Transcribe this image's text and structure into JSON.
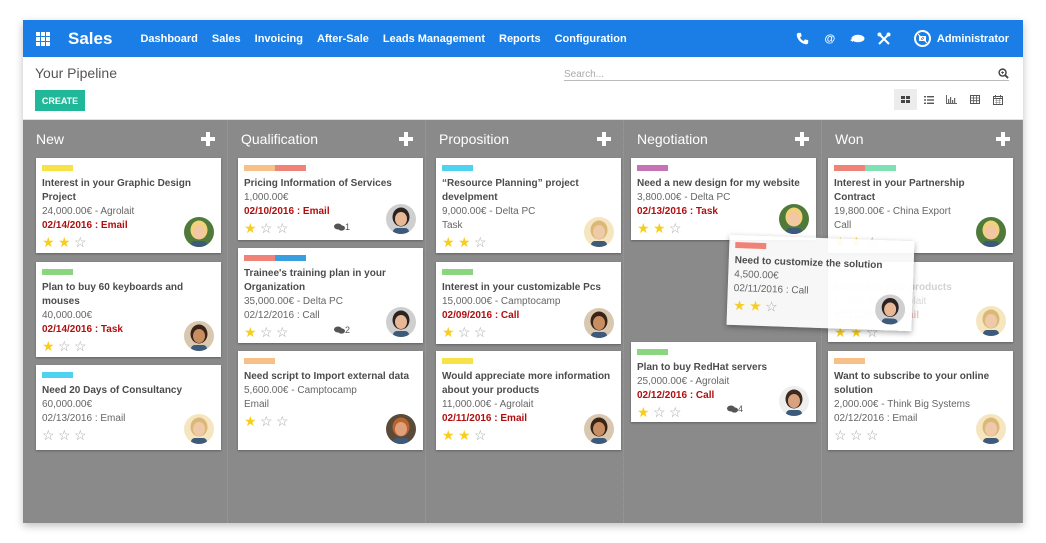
{
  "navbar": {
    "app_name": "Sales",
    "menu": [
      "Dashboard",
      "Sales",
      "Invoicing",
      "After-Sale",
      "Leads Management",
      "Reports",
      "Configuration"
    ],
    "icons": [
      "phone-icon",
      "at-icon",
      "chat-icon",
      "tools-icon"
    ],
    "user": "Administrator"
  },
  "control": {
    "title": "Your Pipeline",
    "search_placeholder": "Search...",
    "create_label": "CREATE",
    "views": [
      "kanban",
      "list",
      "graph",
      "pivot",
      "calendar"
    ],
    "active_view": "kanban"
  },
  "colors": {
    "navbar": "#1a7ee6",
    "create": "#21b799",
    "overdue": "#b10f0f",
    "star": "#f7cd1f",
    "kanban_bg": "#8a8a8a"
  },
  "columns": [
    {
      "title": "New",
      "cards": [
        {
          "tags": [
            "#f7e348"
          ],
          "title": "Interest in your Graphic Design Project",
          "amount": "24,000.00€ - Agrolait",
          "activity": "02/14/2016 : Email",
          "overdue": true,
          "stars": 2,
          "messages": "",
          "avatar": "blonde"
        },
        {
          "tags": [
            "#8ad57e"
          ],
          "title": "Plan to buy 60 keyboards and mouses",
          "amount": "40,000.00€",
          "activity": "02/14/2016 : Task",
          "overdue": true,
          "stars": 1,
          "messages": "",
          "avatar": "beard"
        },
        {
          "tags": [
            "#4fd2ef"
          ],
          "title": "Need 20 Days of Consultancy",
          "amount": "60,000.00€",
          "activity": "02/13/2016 : Email",
          "overdue": false,
          "stars": 0,
          "messages": "",
          "avatar": "blond-man"
        }
      ]
    },
    {
      "title": "Qualification",
      "cards": [
        {
          "tags": [
            "#f7c088",
            "#f08377"
          ],
          "title": "Pricing Information of Services",
          "amount": "1,000.00€",
          "activity": "02/10/2016 : Email",
          "overdue": true,
          "stars": 1,
          "messages": "1",
          "avatar": "dark-hair"
        },
        {
          "tags": [
            "#f08377",
            "#3a9fe0"
          ],
          "title": "Trainee's training plan in your Organization",
          "amount": "35,000.00€ - Delta PC",
          "activity": "02/12/2016 : Call",
          "overdue": false,
          "stars": 1,
          "messages": "2",
          "avatar": "dark-hair"
        },
        {
          "tags": [
            "#f7c088"
          ],
          "title": "Need script to Import external data",
          "amount": "5,600.00€ - Camptocamp",
          "activity": "Email",
          "overdue": false,
          "stars": 1,
          "messages": "",
          "avatar": "ginger"
        }
      ]
    },
    {
      "title": "Proposition",
      "cards": [
        {
          "tags": [
            "#4fd2ef"
          ],
          "title": "“Resource Planning” project develpment",
          "amount": "9,000.00€ - Delta PC",
          "activity": "Task",
          "overdue": false,
          "stars": 2,
          "messages": "",
          "avatar": "blond-man"
        },
        {
          "tags": [
            "#8ad57e"
          ],
          "title": "Interest in your customizable Pcs",
          "amount": "15,000.00€ - Camptocamp",
          "activity": "02/09/2016 : Call",
          "overdue": true,
          "stars": 1,
          "messages": "",
          "avatar": "beard"
        },
        {
          "tags": [
            "#f7e348"
          ],
          "title": "Would appreciate more information about your products",
          "amount": "11,000.00€ - Agrolait",
          "activity": "02/11/2016 : Email",
          "overdue": true,
          "stars": 2,
          "messages": "",
          "avatar": "beard"
        }
      ]
    },
    {
      "title": "Negotiation",
      "cards": [
        {
          "tags": [
            "#c573b5"
          ],
          "title": "Need a new design for my website",
          "amount": "3,800.00€ - Delta PC",
          "activity": "02/13/2016 : Task",
          "overdue": true,
          "stars": 2,
          "messages": "",
          "avatar": "blonde"
        },
        {
          "tags": [
            "#8ad57e"
          ],
          "title": "Plan to buy RedHat servers",
          "amount": "25,000.00€ - Agrolait",
          "activity": "02/12/2016 : Call",
          "overdue": true,
          "stars": 1,
          "messages": "4",
          "avatar": "dark-man"
        }
      ]
    },
    {
      "title": "Won",
      "cards": [
        {
          "tags": [
            "#f08377",
            "#7fe0b3"
          ],
          "title": "Interest in your Partnership Contract",
          "amount": "19,800.00€ - China Export",
          "activity": "Call",
          "overdue": false,
          "stars": 2,
          "messages": "",
          "avatar": "blonde"
        },
        {
          "tags": [],
          "title": "Interest in your products",
          "amount": "2?,000.00€ - Agrolait",
          "activity": "02/11/2016 : Email",
          "overdue": true,
          "stars": 2,
          "messages": "",
          "avatar": "blond-man"
        },
        {
          "tags": [
            "#f7c088"
          ],
          "title": "Want to subscribe to your online solution",
          "amount": "2,000.00€ - Think Big Systems",
          "activity": "02/12/2016 : Email",
          "overdue": false,
          "stars": 0,
          "messages": "",
          "avatar": "blond-man"
        }
      ]
    }
  ],
  "dragging_card": {
    "tags": [
      "#f08377"
    ],
    "title": "Need to customize the solution",
    "amount": "4,500.00€",
    "activity": "02/11/2016 : Call",
    "overdue": false,
    "stars": 2,
    "messages": "",
    "avatar": "dark-hair"
  }
}
